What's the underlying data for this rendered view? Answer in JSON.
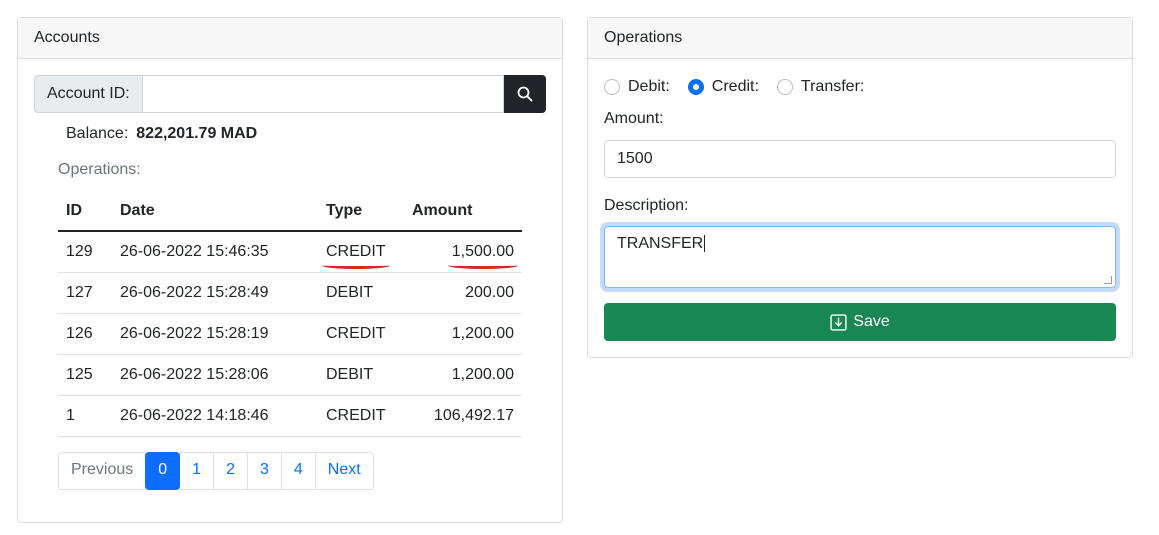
{
  "accounts": {
    "title": "Accounts",
    "account_id_label": "Account ID:",
    "account_id_value": "",
    "balance_label": "Balance:",
    "balance_value": "822,201.79 MAD",
    "operations_label": "Operations:",
    "table": {
      "headers": [
        "ID",
        "Date",
        "Type",
        "Amount"
      ],
      "rows": [
        {
          "id": "129",
          "date": "26-06-2022 15:46:35",
          "type": "CREDIT",
          "amount": "1,500.00"
        },
        {
          "id": "127",
          "date": "26-06-2022 15:28:49",
          "type": "DEBIT",
          "amount": "200.00"
        },
        {
          "id": "126",
          "date": "26-06-2022 15:28:19",
          "type": "CREDIT",
          "amount": "1,200.00"
        },
        {
          "id": "125",
          "date": "26-06-2022 15:28:06",
          "type": "DEBIT",
          "amount": "1,200.00"
        },
        {
          "id": "1",
          "date": "26-06-2022 14:18:46",
          "type": "CREDIT",
          "amount": "106,492.17"
        }
      ]
    },
    "pagination": {
      "previous": "Previous",
      "pages": [
        "0",
        "1",
        "2",
        "3",
        "4"
      ],
      "active_page": "0",
      "next": "Next"
    }
  },
  "operations": {
    "title": "Operations",
    "radios": [
      {
        "label": "Debit:",
        "checked": false
      },
      {
        "label": "Credit:",
        "checked": true
      },
      {
        "label": "Transfer:",
        "checked": false
      }
    ],
    "amount_label": "Amount:",
    "amount_value": "1500",
    "description_label": "Description:",
    "description_value": "TRANSFER",
    "save_label": "Save"
  },
  "colors": {
    "primary": "#0d6efd",
    "success": "#198754",
    "dark": "#212529",
    "annotation": "#e0252b"
  },
  "icons": {
    "search": "search-icon",
    "save": "save-icon"
  }
}
